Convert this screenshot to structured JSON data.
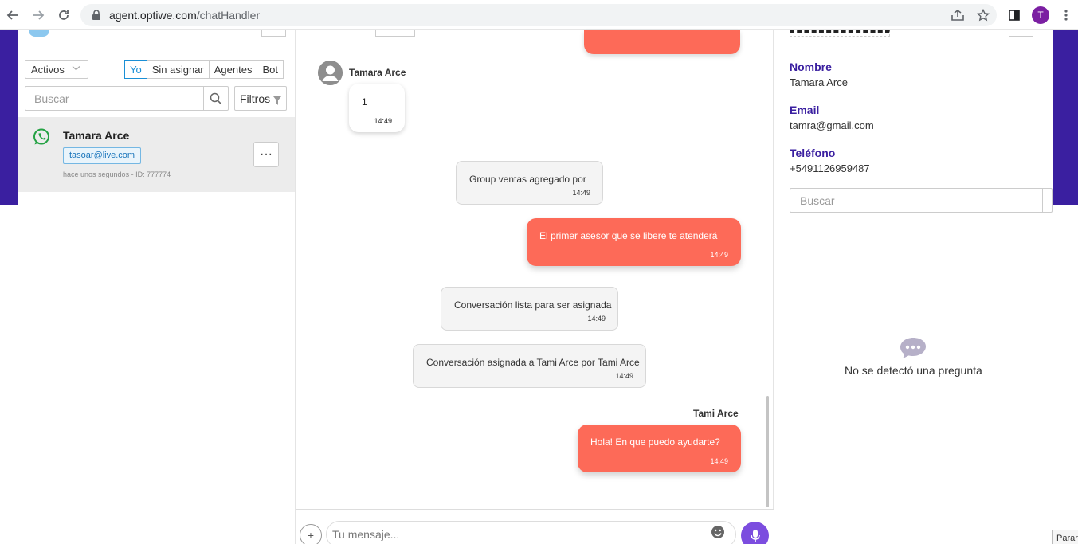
{
  "browser": {
    "url_host": "agent.optiwe.com",
    "url_path": "/chatHandler",
    "profile_initial": "T"
  },
  "conversations_panel": {
    "status_select": "Activos",
    "filter_tabs": [
      {
        "label": "Yo",
        "active": true
      },
      {
        "label": "Sin asignar",
        "active": false
      },
      {
        "label": "Agentes",
        "active": false
      },
      {
        "label": "Bot",
        "active": false
      }
    ],
    "search_placeholder": "Buscar",
    "filters_label": "Filtros",
    "items": [
      {
        "channel_icon": "whatsapp-icon",
        "name": "Tamara Arce",
        "tag": "tasoar@live.com",
        "meta": "hace unos segundos - ID: 777774"
      }
    ],
    "more_label": "···"
  },
  "chat": {
    "messages": [
      {
        "type": "incoming",
        "sender": "Tamara Arce",
        "text": "1",
        "time": "14:49"
      },
      {
        "type": "system",
        "text": "Group ventas agregado por",
        "time": "14:49"
      },
      {
        "type": "outgoing",
        "text": "El primer asesor que se libere te atenderá",
        "time": "14:49"
      },
      {
        "type": "system",
        "text": "Conversación lista para ser asignada",
        "time": "14:49"
      },
      {
        "type": "system",
        "text": "Conversación asignada a Tami Arce por Tami Arce",
        "time": "14:49"
      },
      {
        "type": "outgoing",
        "sender": "Tami Arce",
        "text": "Hola! En que puedo ayudarte?",
        "time": "14:49"
      }
    ],
    "input_placeholder": "Tu mensaje...",
    "plus_label": "+"
  },
  "contact_panel": {
    "fields": [
      {
        "label": "Nombre",
        "value": "Tamara Arce"
      },
      {
        "label": "Email",
        "value": "tamra@gmail.com"
      },
      {
        "label": "Teléfono",
        "value": "+5491126959487"
      }
    ],
    "search_placeholder": "Buscar",
    "empty_state": "No se detectó una pregunta"
  },
  "floating_tab": {
    "label": "Parar"
  },
  "colors": {
    "brand_purple": "#3a1fa0",
    "outgoing_bubble": "#fd6a58",
    "whatsapp_green": "#25a244",
    "active_tab_blue": "#1a8fd6"
  }
}
